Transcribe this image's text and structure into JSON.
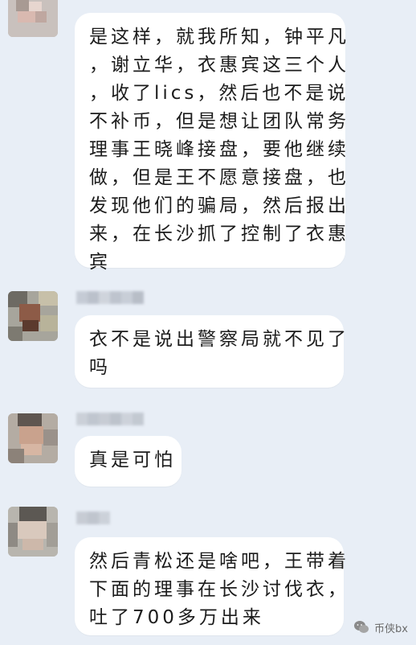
{
  "messages": [
    {
      "lines": [
        "是这样，就我所知，钟平凡",
        "，谢立华，衣惠宾这三个人",
        "，收了lics，然后也不是说",
        "不补币，但是想让团队常务",
        "理事王晓峰接盘，要他继续",
        "做，但是王不愿意接盘，也",
        "发现他们的骗局，然后报出",
        "来，在长沙抓了控制了衣惠",
        "宾"
      ]
    },
    {
      "lines": [
        "衣不是说出警察局就不见了",
        "吗"
      ]
    },
    {
      "lines": [
        "真是可怕"
      ]
    },
    {
      "lines": [
        "然后青松还是啥吧，王带着",
        "下面的理事在长沙讨伐衣，",
        "吐了700多万出来"
      ]
    }
  ],
  "watermark": {
    "text": "币侠bx",
    "icon": "wechat-logo-icon"
  },
  "colors": {
    "background": "#e8eef6",
    "bubble": "#ffffff",
    "text": "#1c1c1c"
  }
}
